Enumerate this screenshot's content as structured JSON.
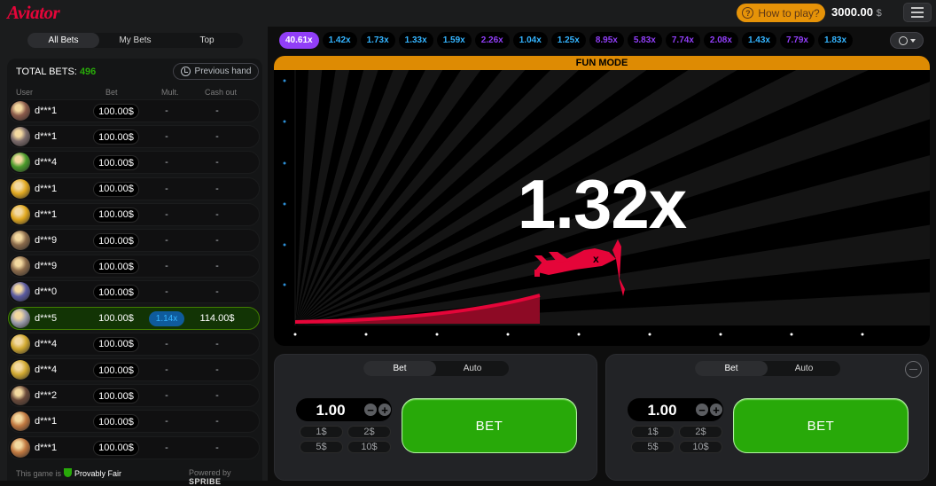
{
  "header": {
    "logo": "Aviator",
    "howto_label": "How to play?",
    "balance": "3000.00",
    "currency": "$"
  },
  "bets": {
    "tabs": [
      "All Bets",
      "My Bets",
      "Top"
    ],
    "total_label": "TOTAL BETS:",
    "total_count": "496",
    "prev_hand_label": "Previous hand",
    "columns": [
      "User",
      "Bet",
      "Mult.",
      "Cash out"
    ],
    "rows": [
      {
        "user": "d***1",
        "bet": "100.00$",
        "mult": "-",
        "cashout": "-",
        "avatar_color": "#8a5a4a",
        "win": false
      },
      {
        "user": "d***1",
        "bet": "100.00$",
        "mult": "-",
        "cashout": "-",
        "avatar_color": "#7a6a6a",
        "win": false
      },
      {
        "user": "d***4",
        "bet": "100.00$",
        "mult": "-",
        "cashout": "-",
        "avatar_color": "#4a9a2a",
        "win": false
      },
      {
        "user": "d***1",
        "bet": "100.00$",
        "mult": "-",
        "cashout": "-",
        "avatar_color": "#e0a820",
        "win": false
      },
      {
        "user": "d***1",
        "bet": "100.00$",
        "mult": "-",
        "cashout": "-",
        "avatar_color": "#e0a820",
        "win": false
      },
      {
        "user": "d***9",
        "bet": "100.00$",
        "mult": "-",
        "cashout": "-",
        "avatar_color": "#8a6a4a",
        "win": false
      },
      {
        "user": "d***9",
        "bet": "100.00$",
        "mult": "-",
        "cashout": "-",
        "avatar_color": "#8a6a4a",
        "win": false
      },
      {
        "user": "d***0",
        "bet": "100.00$",
        "mult": "-",
        "cashout": "-",
        "avatar_color": "#5a5aa0",
        "win": false
      },
      {
        "user": "d***5",
        "bet": "100.00$",
        "mult": "1.14x",
        "cashout": "114.00$",
        "avatar_color": "#9a9aaa",
        "win": true
      },
      {
        "user": "d***4",
        "bet": "100.00$",
        "mult": "-",
        "cashout": "-",
        "avatar_color": "#d0a830",
        "win": false
      },
      {
        "user": "d***4",
        "bet": "100.00$",
        "mult": "-",
        "cashout": "-",
        "avatar_color": "#d0a830",
        "win": false
      },
      {
        "user": "d***2",
        "bet": "100.00$",
        "mult": "-",
        "cashout": "-",
        "avatar_color": "#6a4a3a",
        "win": false
      },
      {
        "user": "d***1",
        "bet": "100.00$",
        "mult": "-",
        "cashout": "-",
        "avatar_color": "#c07840",
        "win": false
      },
      {
        "user": "d***1",
        "bet": "100.00$",
        "mult": "-",
        "cashout": "-",
        "avatar_color": "#c07840",
        "win": false
      }
    ],
    "footer_prefix": "This game is",
    "provably_fair": "Provably Fair",
    "powered_by": "Powered by",
    "provider": "SPRIBE"
  },
  "history": [
    {
      "v": "40.61x",
      "c": "first"
    },
    {
      "v": "1.42x",
      "c": "blue"
    },
    {
      "v": "1.73x",
      "c": "blue"
    },
    {
      "v": "1.33x",
      "c": "blue"
    },
    {
      "v": "1.59x",
      "c": "blue"
    },
    {
      "v": "2.26x",
      "c": "purple"
    },
    {
      "v": "1.04x",
      "c": "blue"
    },
    {
      "v": "1.25x",
      "c": "blue"
    },
    {
      "v": "8.95x",
      "c": "purple"
    },
    {
      "v": "5.83x",
      "c": "purple"
    },
    {
      "v": "7.74x",
      "c": "purple"
    },
    {
      "v": "2.08x",
      "c": "purple"
    },
    {
      "v": "1.43x",
      "c": "blue"
    },
    {
      "v": "7.79x",
      "c": "purple"
    },
    {
      "v": "1.83x",
      "c": "blue"
    }
  ],
  "game": {
    "mode_label": "FUN MODE",
    "multiplier": "1.32x"
  },
  "bet_panels": [
    {
      "tabs": [
        "Bet",
        "Auto"
      ],
      "amount": "1.00",
      "quick": [
        "1$",
        "2$",
        "5$",
        "10$"
      ],
      "button": "BET"
    },
    {
      "tabs": [
        "Bet",
        "Auto"
      ],
      "amount": "1.00",
      "quick": [
        "1$",
        "2$",
        "5$",
        "10$"
      ],
      "button": "BET"
    }
  ],
  "colors": {
    "brand": "#e50539",
    "win_green": "#28a909",
    "fun_mode": "#de8b03",
    "mult_blue": "#34b4ff",
    "mult_purple": "#913ef8"
  }
}
